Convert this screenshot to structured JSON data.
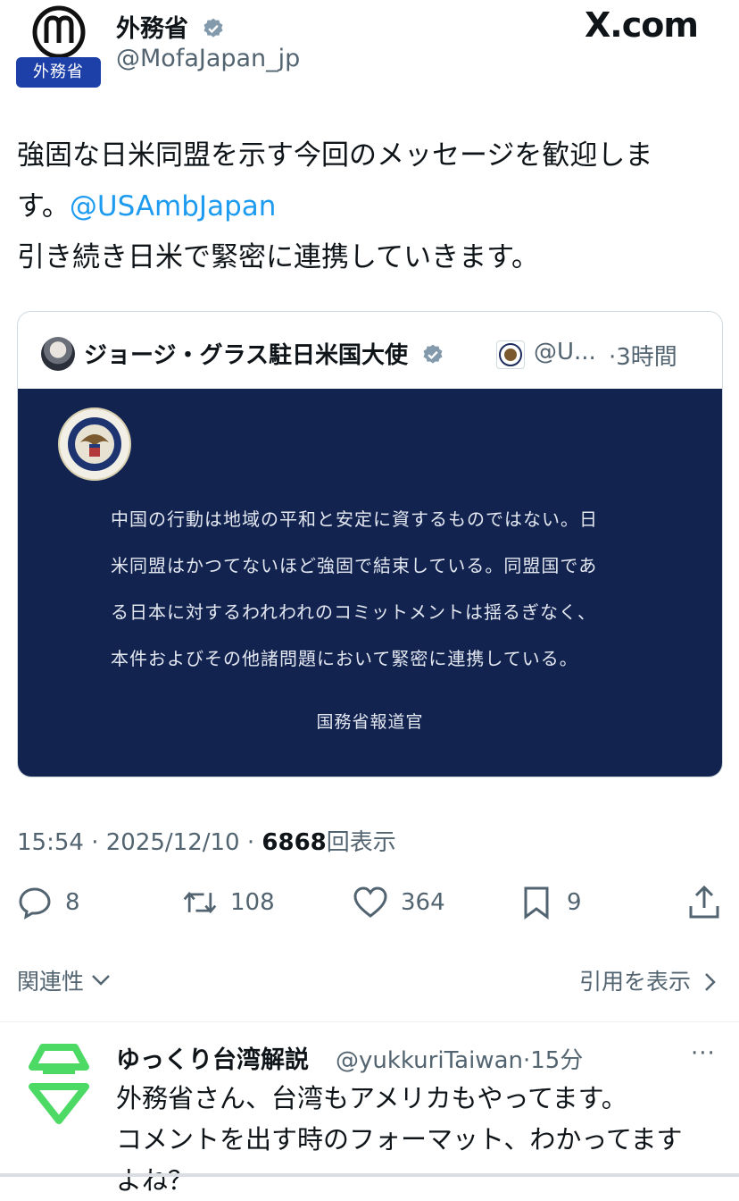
{
  "tweet": {
    "author_name": "外務省",
    "author_handle": "@MofaJapan_jp",
    "avatar_label": "外務省",
    "site": "X.com",
    "text_line1": "強固な日米同盟を示す今回のメッセージを歓迎しま",
    "text_line2_prefix": "す。",
    "text_line2_mention": "@USAmbJapan",
    "text_line3": "引き続き日米で緊密に連携していきます。",
    "time": "15:54",
    "date": "2025/12/10",
    "views": "6868",
    "views_label": "回表示"
  },
  "quote": {
    "author_name": "ジョージ・グラス駐日米国大使",
    "author_handle": "@U...",
    "time": "3時間",
    "statement_lines": [
      "中国の行動は地域の平和と安定に資するものではない。日",
      "米同盟はかつてないほど強固で結束している。同盟国であ",
      "る日本に対するわれわれのコミットメントは揺るぎなく、",
      "本件およびその他諸問題において緊密に連携している。"
    ],
    "statement_signature": "国務省報道官"
  },
  "actions": {
    "replies": "8",
    "retweets": "108",
    "likes": "364",
    "bookmarks": "9"
  },
  "links": {
    "related": "関連性",
    "show_quotes": "引用を表示"
  },
  "reply": {
    "author_name": "ゆっくり台湾解説",
    "author_handle": "@yukkuriTaiwan",
    "time": "15分",
    "text_lines": [
      "外務省さん、台湾もアメリカもやってます。",
      "コメントを出す時のフォーマット、わかってます",
      "よね？"
    ]
  },
  "colors": {
    "accent": "#1d9bf0",
    "muted": "#536471",
    "quote_bg": "#122350",
    "badge": "#1c3fa8",
    "reply_avatar": "#4cd964"
  },
  "icons": [
    "verified-icon",
    "reply-icon",
    "retweet-icon",
    "like-icon",
    "bookmark-icon",
    "share-icon",
    "chevron-down-icon",
    "chevron-right-icon",
    "more-icon"
  ]
}
